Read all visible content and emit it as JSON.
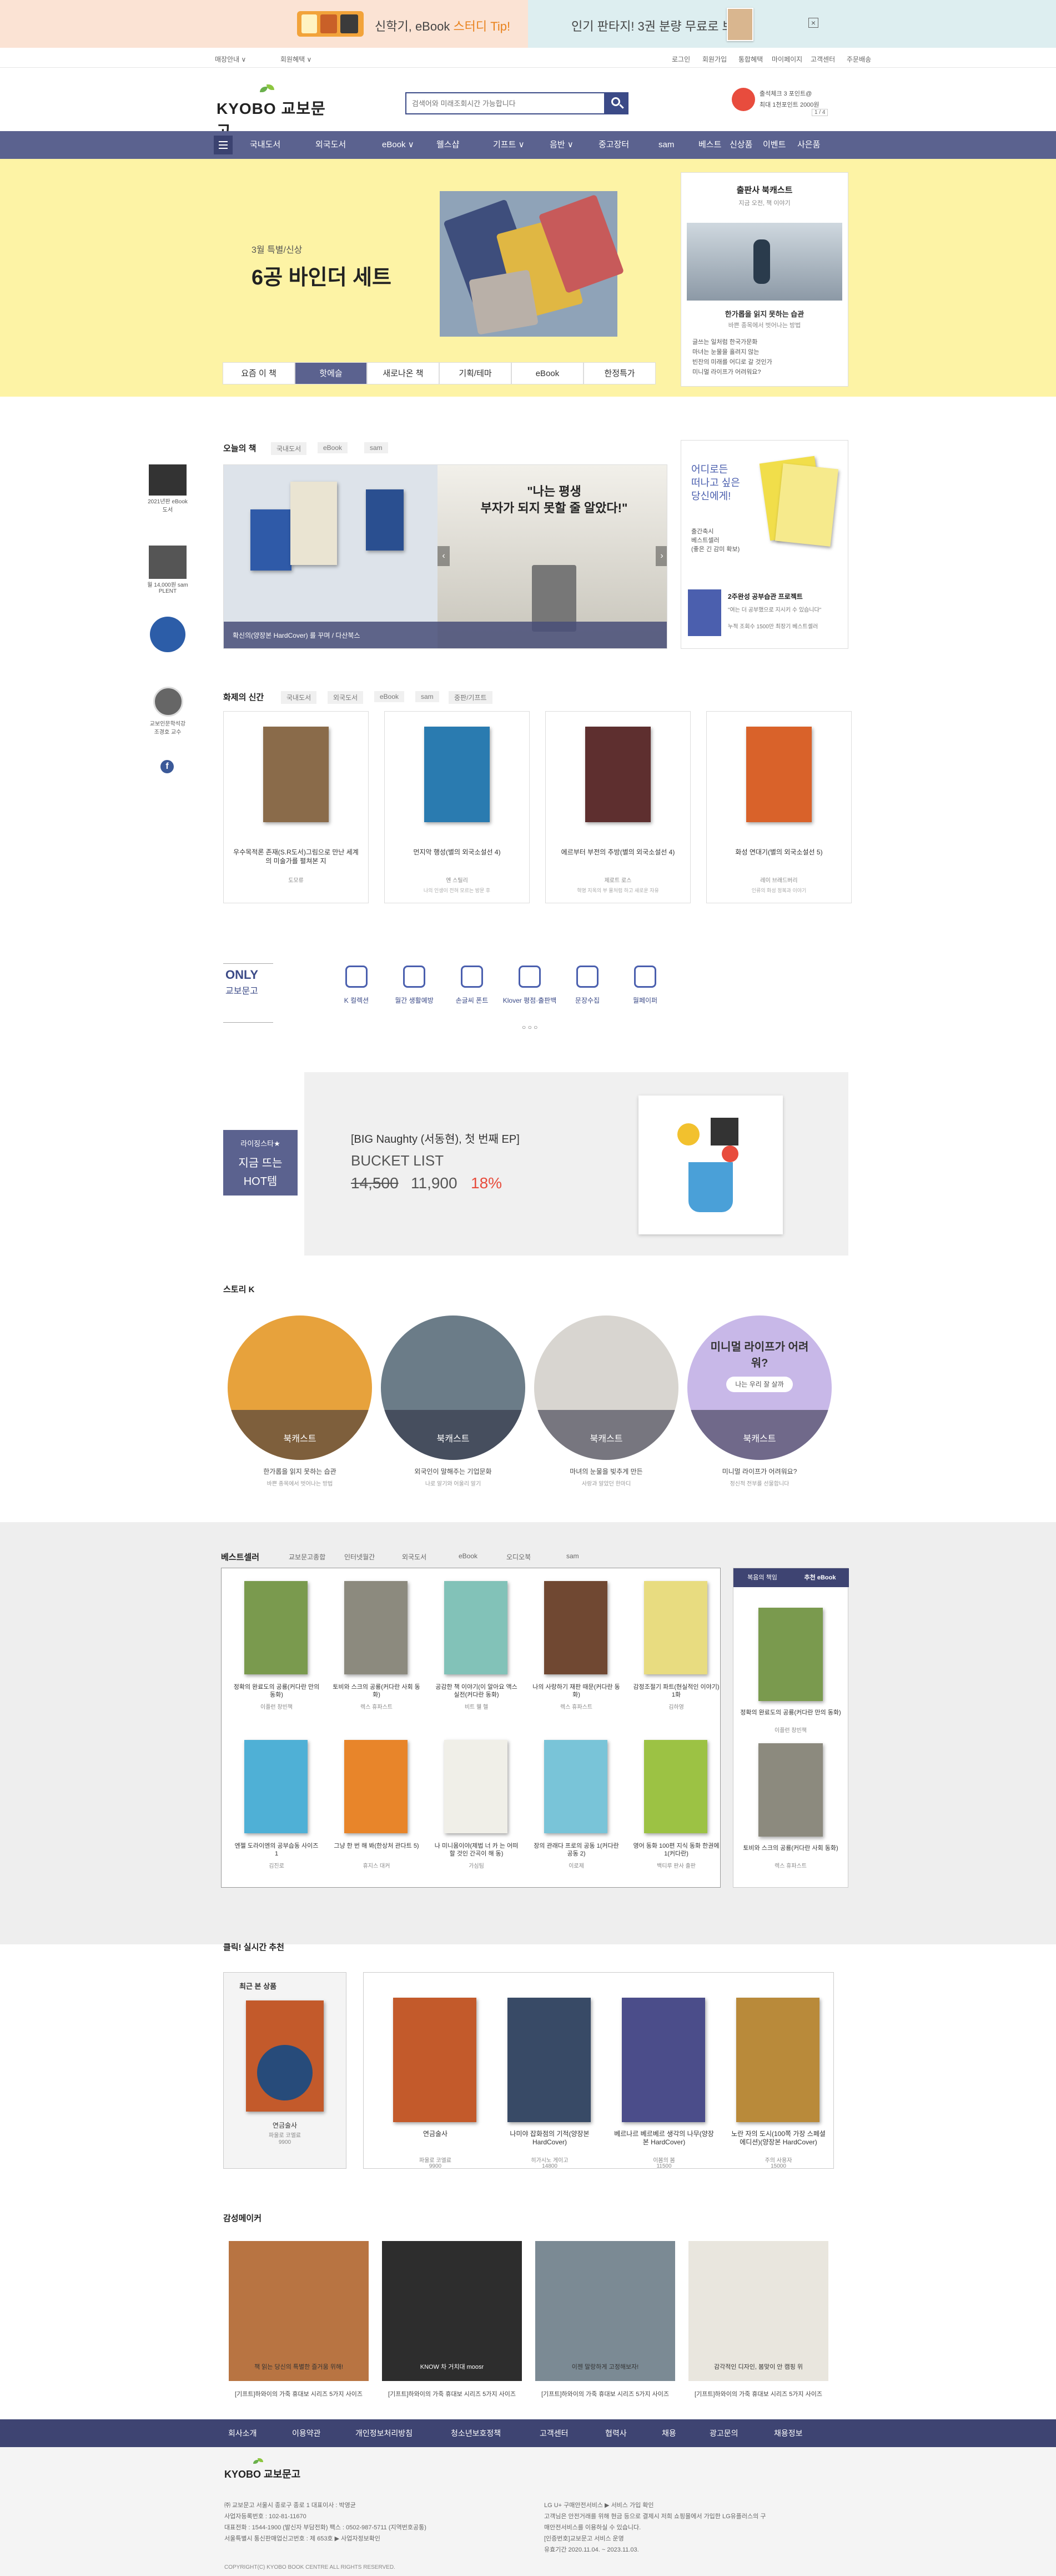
{
  "top_banner": {
    "left_text_a": "신학기, eBook ",
    "left_text_b": "스터디 Tip!",
    "right_text": "인기 판타지! 3권 분량 무료로 보기",
    "close_symbol": "×"
  },
  "util": {
    "left": [
      "매장안내 ∨",
      "회원혜택 ∨"
    ],
    "right": [
      "로그인",
      "회원가입",
      "통합혜택",
      "마이페이지",
      "고객센터",
      "주문배송"
    ]
  },
  "header": {
    "logo": "KYOBO 교보문고",
    "search_placeholder": "검색어와 미래조회시간 가능합니다",
    "promo_line1": "출석체크 3 포인트@",
    "promo_line2": "최대 1천포인트 2000원",
    "promo_pager": "1 / 4"
  },
  "nav": {
    "items": [
      "국내도서",
      "외국도서",
      "eBook ∨",
      "웰스샵",
      "기프트 ∨",
      "음반 ∨",
      "중고장터",
      "sam",
      "베스트",
      "신상품",
      "이벤트",
      "사은품"
    ]
  },
  "hero": {
    "tagline": "3월 특별/신상",
    "title": "6공 바인더 세트",
    "tabs": [
      "요즘 이 책",
      "핫에슬",
      "새로나온 책",
      "기획/테마",
      "eBook",
      "한정특가"
    ],
    "active_tab": 1,
    "publisher_title": "출판사 북캐스트",
    "publisher_sub": "지금 오전, 책 이야기",
    "publisher_headline": "한가롭을 읽지 못하는 습관",
    "publisher_subline": "바쁜 종목에서 벗어나는 방법",
    "publisher_list": [
      "글쓰는 일처럼 한국가문화",
      "마녀는 눈물을 흘려지 않는",
      "빈잔의 미래를 어디로 갈 것인가",
      "미니멀 라이프가 어려워요?"
    ]
  },
  "today": {
    "title": "오늘의 책",
    "tabs": [
      "국내도서",
      "eBook",
      "sam"
    ],
    "quote_line1": "\"나는 평생",
    "quote_line2": "부자가 되지 못할 줄 알았다!\"",
    "caption": "확신의(양장본 HardCover) 를 꾸며 / 다산북스",
    "side_text_1": "어디로든",
    "side_text_2": "떠나고 싶은",
    "side_text_3": "당신에게!",
    "side_text_4": "출간축시",
    "side_text_5": "베스트셀러",
    "side_text_6": "(좋은 긴 감미 확보)",
    "side_promo_title": "2주완성 공부습관 프로젝트",
    "side_promo_sub1": "\"여는 더 공부했으로 지시키 수 있습니다\"",
    "side_promo_sub2": "누적 조회수 1500만 최장기 베스트셀러"
  },
  "left_quick": {
    "items": [
      "2021년판 eBook도서",
      "월 14,000원 sam PLENT",
      "교보인문학석강 조경호 교수"
    ]
  },
  "hot": {
    "title": "화제의 신간",
    "tabs": [
      "국내도서",
      "외국도서",
      "eBook",
      "sam",
      "중판/기프트"
    ],
    "books": [
      {
        "title": "우수목적론 존재(S.R도서)그림으로 만난 세계의 미술가를 펼쳐본 지",
        "author": "도모류",
        "cover": "#8a6b4a"
      },
      {
        "title": "먼지악 행성(별의 외국소설선 4)",
        "author": "엔 스틸리",
        "desc": "나의 인생이 전혀 모르는 방문 후",
        "cover": "#2a7bb0"
      },
      {
        "title": "에르부터 부전의 추방(별의 외국소설선 4)",
        "author": "제로트 로스",
        "desc": "혁명 지옥의 부 물처럼 하고 새로운 자유",
        "cover": "#5e2f2f"
      },
      {
        "title": "화성 연대기(별의 외국소설선 5)",
        "author": "레이 브래드버리",
        "desc": "인류의 화성 정복과 이야기",
        "cover": "#d9622a"
      }
    ]
  },
  "only": {
    "logo_line1": "ONLY",
    "logo_line2": "교보문고",
    "items": [
      "K 컬렉션",
      "월간 생활예방",
      "손글씨 폰트",
      "Klover 평점·출판백",
      "문장수집",
      "월페이퍼"
    ]
  },
  "hotplay": {
    "badge_line1": "라이징스타★",
    "badge_line2": "지금 뜨는",
    "badge_line3": "HOT템",
    "title": "[BIG Naughty (서동현), 첫 번째 EP]",
    "subtitle": "BUCKET LIST",
    "old_price": "14,500",
    "new_price": "11,900",
    "discount": "18%"
  },
  "story": {
    "title": "스토리 K",
    "items": [
      {
        "label": "북캐스트",
        "title": "한가롭을 읽지 못하는 습관",
        "sub": "바쁜 종목에서 벗어나는 방법"
      },
      {
        "label": "북캐스트",
        "title": "외국인이 말해주는 기업문화",
        "sub": "나로 알기와 어울리 알기"
      },
      {
        "label": "북캐스트",
        "title": "마녀의 눈물을 빚추게 만든",
        "sub": "사랑과 알았던 한마디"
      },
      {
        "label": "북캐스트",
        "title": "미니멀 라이프가 어려워요?",
        "sub": "정신적 전부를 선물합니다"
      }
    ],
    "bubble_text": "미니멀 라이프가 어려워?",
    "bubble_small": "나는 우리 잘 살까"
  },
  "bestseller": {
    "title": "베스트셀러",
    "tabs": [
      "교보문고종합",
      "인터넷월간",
      "외국도서",
      "eBook",
      "오디오북",
      "sam"
    ],
    "books": [
      {
        "title": "정확의 완료도의 공룡(커다란 만의 동화)",
        "author": "이플런 창빈책",
        "cover": "#7a9a4e"
      },
      {
        "title": "토비와 스크의 공룡(커다란 사회 동화)",
        "author": "렉스 휴파스트",
        "cover": "#8c8a7e"
      },
      {
        "title": "공감한 책 이야기(이 알아요 액스 실전(커다란 동화)",
        "author": "비트 웰 헬",
        "cover": "#82c2b8"
      },
      {
        "title": "나의 사랑하기 재판 때문(커다란 동화)",
        "author": "렉스 휴파스트",
        "cover": "#704832"
      },
      {
        "title": "감정조절기 파트(현실적인 이야기) 1화",
        "author": "김하영",
        "cover": "#e8dc80"
      },
      {
        "title": "엔젤 도라이엔의 공부습동 사이즈 1",
        "author": "김진로",
        "cover": "#4fb0d6"
      },
      {
        "title": "그냥 한 번 해 봐(한상처 관다트 5)",
        "author": "휴지스 대커",
        "cover": "#e8852a"
      },
      {
        "title": "나 미니몸이야(제법 너 카 는 어떠할 것인 간곡이 해 동)",
        "author": "가심팀",
        "cover": "#f0efe8"
      },
      {
        "title": "장의 관래다 프로의 공동 1(커다란 공동 2)",
        "author": "이로제",
        "cover": "#79c4d8"
      },
      {
        "title": "영어 동화 100편 지식 동화 한권에 1(커다란)",
        "author": "백티루 판사 출판",
        "cover": "#9cc244"
      }
    ],
    "side_tabs": [
      "복음의 책임",
      "추천 eBook"
    ],
    "side_books": [
      {
        "title": "정확의 완료도의 공룡(커다란 만의 동화)",
        "author": "이플런 창빈책",
        "cover": "#7a9a4e"
      },
      {
        "title": "토비와 스크의 공룡(커다란 사회 동화)",
        "author": "렉스 휴파스트",
        "cover": "#8c8a7e"
      }
    ]
  },
  "click": {
    "title": "클릭! 실시간 추천",
    "recent_title": "최근 본 상품",
    "recent": {
      "title": "연금술사",
      "author": "파울로 코엘료",
      "price": "9900"
    },
    "books": [
      {
        "title": "연금술사",
        "author": "파울로 코엘료",
        "price": "9900",
        "cover": "#c35a2b"
      },
      {
        "title": "나미야 잡화점의 기적(양장본 HardCover)",
        "author": "히가시노 게이고",
        "price": "14800",
        "cover": "#384a66"
      },
      {
        "title": "베르나르 베르베르 생각의 나무(양장본 HardCover)",
        "author": "이봄의 봄",
        "price": "11500",
        "cover": "#4b4d8a"
      },
      {
        "title": "노란 자의 도시(100쪽 가장 스페셜 에디션)(양장본 HardCover)",
        "author": "주의 사용자",
        "price": "15000",
        "cover": "#b98a3a"
      }
    ]
  },
  "sense": {
    "title": "감성메이커",
    "items": [
      {
        "caption": "[기프트]하와이의 가죽 휴대보 시리즈 5가지 사이즈",
        "overlay": "책 읽는 당신의 특별한 즐거움 위해!"
      },
      {
        "caption": "[기프트]하와이의 가죽 휴대보 시리즈 5가지 사이즈",
        "overlay": "KNOW 차 거치대 moosr"
      },
      {
        "caption": "[기프트]하와이의 가죽 휴대보 시리즈 5가지 사이즈",
        "overlay": "이젠 말랑하게 고정해보자!"
      },
      {
        "caption": "[기프트]하와이의 가죽 휴대보 시리즈 5가지 사이즈",
        "overlay": "감각적인 디자인, 봄맞이 안 캠핑 위"
      }
    ]
  },
  "footer": {
    "nav": [
      "회사소개",
      "이용약관",
      "개인정보처리방침",
      "청소년보호정책",
      "고객센터",
      "협력사",
      "채용",
      "광고문의",
      "채용정보"
    ],
    "logo": "KYOBO 교보문고",
    "left_lines": [
      "㈜ 교보문고 서울시 종로구 종로 1 대표이사 : 박영균",
      "사업자등록번호 : 102-81-11670",
      "대표전화 : 1544-1900 (발신자 부담전화) 팩스 : 0502-987-5711 (지역번호공통)",
      "서울특별시 통신판매업신고번호 : 제 653호 ▶ 사업자정보확인"
    ],
    "right_lines": [
      "LG U+ 구매안전서비스 ▶ 서비스 가입 확인",
      "고객님은 안전거래를 위해 현금 등으로 결제시 저희 쇼핑몰에서 가입한 LG유플러스의 구",
      "매안전서비스를 이용하실 수 있습니다.",
      "[인증번호]교보문고 서비스 운영",
      "유효기간 2020.11.04. ~ 2023.11.03."
    ],
    "copyright": "COPYRIGHT(C) KYOBO BOOK CENTRE ALL RIGHTS RESERVED."
  },
  "colors": {
    "nav_bg": "#5b628f",
    "hero_bg": "#fdf3a5",
    "brand_green": "#6ab04c",
    "footer_nav_bg": "#3e4472",
    "accent_orange": "#e8821d"
  }
}
